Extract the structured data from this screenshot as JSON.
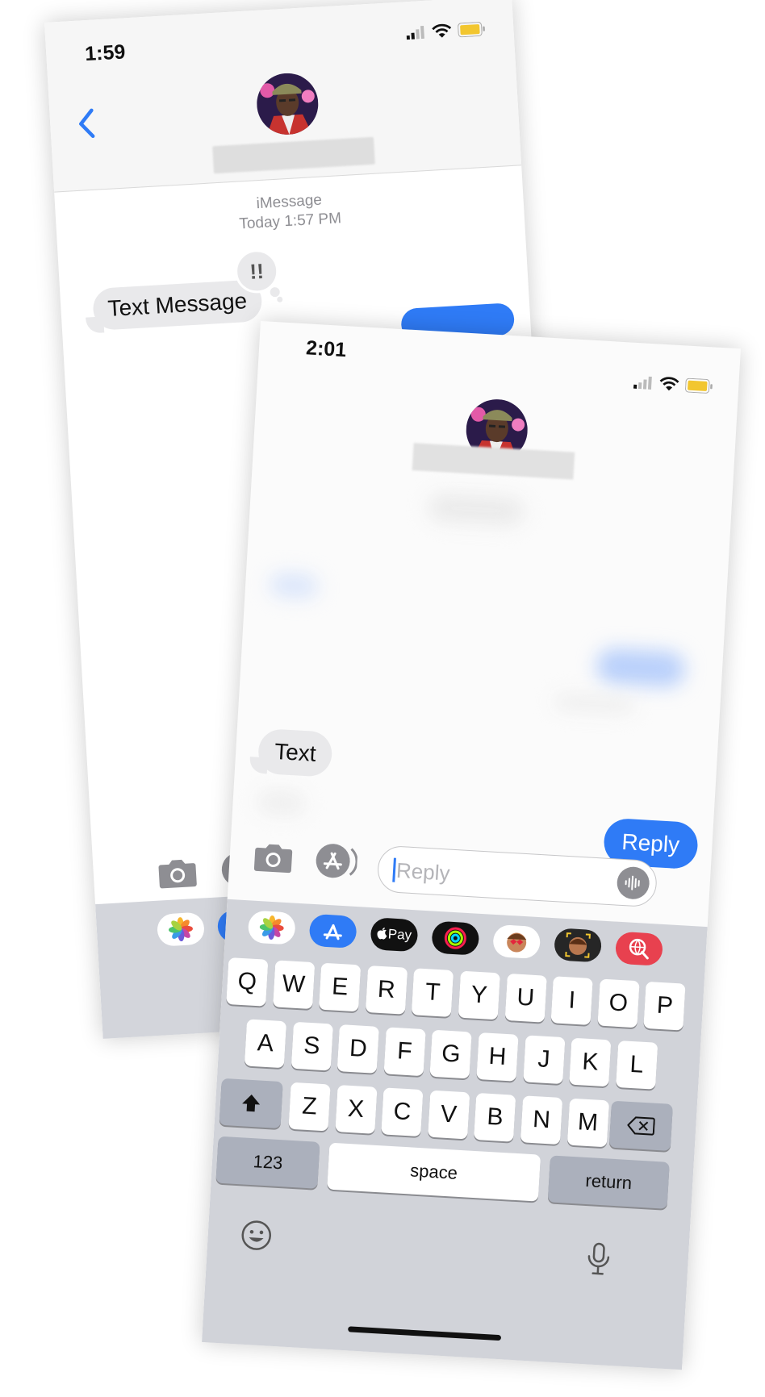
{
  "back_screen": {
    "status": {
      "time": "1:59"
    },
    "conversation": {
      "service": "iMessage",
      "timestamp": "Today 1:57 PM",
      "messages": [
        {
          "direction": "incoming",
          "text": "Text Message",
          "tapback": "!!"
        }
      ]
    },
    "colors": {
      "accent": "#2f7bf6",
      "bubble_incoming": "#e9e9eb"
    }
  },
  "front_screen": {
    "status": {
      "time": "2:01"
    },
    "conversation": {
      "messages": [
        {
          "direction": "incoming",
          "text": "Text"
        },
        {
          "direction": "outgoing",
          "text": "Reply"
        }
      ]
    },
    "compose": {
      "placeholder": "Reply"
    },
    "app_drawer": {
      "items": [
        "photos-icon",
        "app-store-icon",
        "apple-pay-icon",
        "activity-icon",
        "memoji-stickers-icon",
        "memoji-icon",
        "web-images-icon"
      ],
      "apple_pay_label": "Pay"
    },
    "keyboard": {
      "rows": [
        [
          "Q",
          "W",
          "E",
          "R",
          "T",
          "Y",
          "U",
          "I",
          "O",
          "P"
        ],
        [
          "A",
          "S",
          "D",
          "F",
          "G",
          "H",
          "J",
          "K",
          "L"
        ],
        [
          "Z",
          "X",
          "C",
          "V",
          "B",
          "N",
          "M"
        ]
      ],
      "numbers_label": "123",
      "space_label": "space",
      "return_label": "return"
    },
    "colors": {
      "accent": "#2f7bf6",
      "keyboard_bg": "#d1d3d9"
    }
  }
}
